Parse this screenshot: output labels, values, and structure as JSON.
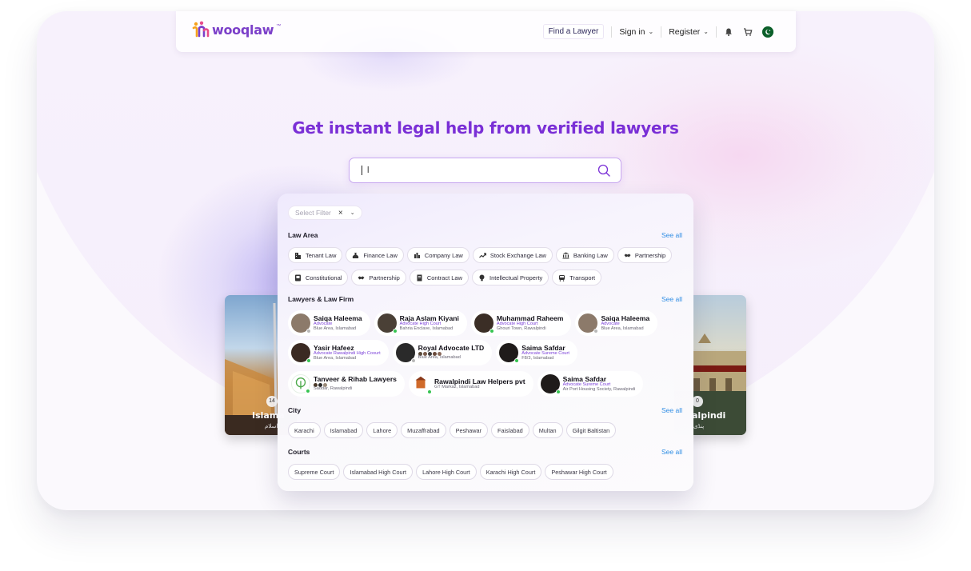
{
  "header": {
    "logo_text": "wooqlaw",
    "logo_tm": "™",
    "find_lawyer": "Find a Lawyer",
    "sign_in": "Sign in",
    "register": "Register",
    "icons": [
      "bell-icon",
      "cart-icon",
      "pakistan-flag-icon"
    ]
  },
  "hero": {
    "title": "Get instant legal help from verified lawyers",
    "search_value": "l"
  },
  "filter": {
    "placeholder": "Select Filter"
  },
  "law_area": {
    "title": "Law Area",
    "see_all": "See all",
    "row1": [
      {
        "label": "Tenant Law",
        "icon": "building-icon"
      },
      {
        "label": "Finance Law",
        "icon": "money-bag-icon"
      },
      {
        "label": "Company Law",
        "icon": "company-icon"
      },
      {
        "label": "Stock Exchange Law",
        "icon": "trend-icon"
      },
      {
        "label": "Banking Law",
        "icon": "bank-icon"
      },
      {
        "label": "Partnership",
        "icon": "handshake-icon"
      }
    ],
    "row2": [
      {
        "label": "Constitutional",
        "icon": "book-icon"
      },
      {
        "label": "Partnership",
        "icon": "handshake-icon"
      },
      {
        "label": "Contract Law",
        "icon": "document-icon"
      },
      {
        "label": "Intellectual Property",
        "icon": "bulb-icon"
      },
      {
        "label": "Transport",
        "icon": "bus-icon"
      }
    ]
  },
  "lawyers": {
    "title": "Lawyers & Law Firm",
    "see_all": "See all",
    "row1": [
      {
        "name": "Saiqa Haleema",
        "role": "Advocate",
        "location": "Blue Area, Islamabad",
        "avatar_color": "#8c7a6a",
        "online": false
      },
      {
        "name": "Raja Aslam Kiyani",
        "role": "Advocate High Court",
        "location": "Bahria Enclave, Islamabad",
        "avatar_color": "#4a4036",
        "online": true
      },
      {
        "name": "Muhammad Raheem",
        "role": "Advocate High Court",
        "location": "Ghouri Town, Rawalpindi",
        "avatar_color": "#3b2e26",
        "online": true
      },
      {
        "name": "Saiqa Haleema",
        "role": "Advocate",
        "location": "Blue Area, Islamabad",
        "avatar_color": "#8c7a6a",
        "online": false
      }
    ],
    "row2": [
      {
        "name": "Yasir Hafeez",
        "role": "Advocate Rawalpindi High Coourt",
        "location": "Blue Area, Islamabad",
        "avatar_color": "#3a2a22",
        "online": true
      },
      {
        "name": "Royal Advocate LTD",
        "role": "",
        "location": "Blue Area, Islamabad",
        "avatar_color": "#2a2a2a",
        "online": false
      },
      {
        "name": "Saima Safdar",
        "role": "Advocate Sureme Court",
        "location": "F8/3, Islamabad",
        "avatar_color": "#1f1b1a",
        "online": true
      }
    ],
    "row3": [
      {
        "name": "Tanveer & Rihab Lawyers",
        "role": "",
        "location": "Saddar, Rawalpindi",
        "avatar_color": "#ffffff",
        "online": true
      },
      {
        "name": "Rawalpindi Law Helpers pvt",
        "role": "",
        "location": "GT Markaz, Islamabad",
        "avatar_color": "#ffffff",
        "online": true
      },
      {
        "name": "Saima Safdar",
        "role": "Advocate Sureme Court",
        "location": "Air Port Housing Society, Rawalpindi",
        "avatar_color": "#1f1b1a",
        "online": true
      }
    ]
  },
  "city": {
    "title": "City",
    "see_all": "See all",
    "items": [
      "Karachi",
      "Islamabad",
      "Lahore",
      "Muzaffrabad",
      "Peshawar",
      "Faislabad",
      "Multan",
      "Gilgit Baltistan"
    ]
  },
  "courts": {
    "title": "Courts",
    "see_all": "See all",
    "items": [
      "Supreme Court",
      "Islamabad High Court",
      "Lahore High Court",
      "Karachi High Court",
      "Peshawar High Court"
    ]
  },
  "city_cards": [
    {
      "name": "Islamabad",
      "visible_name": "Islama",
      "count": "14",
      "urdu": "اسلام"
    },
    {
      "name": "Rawalpindi",
      "visible_name": "alpindi",
      "count": "0",
      "urdu": "پنڈی"
    }
  ],
  "colors": {
    "brand_purple": "#7a2fd6",
    "link_blue": "#2f8de4",
    "online_green": "#37c452"
  }
}
